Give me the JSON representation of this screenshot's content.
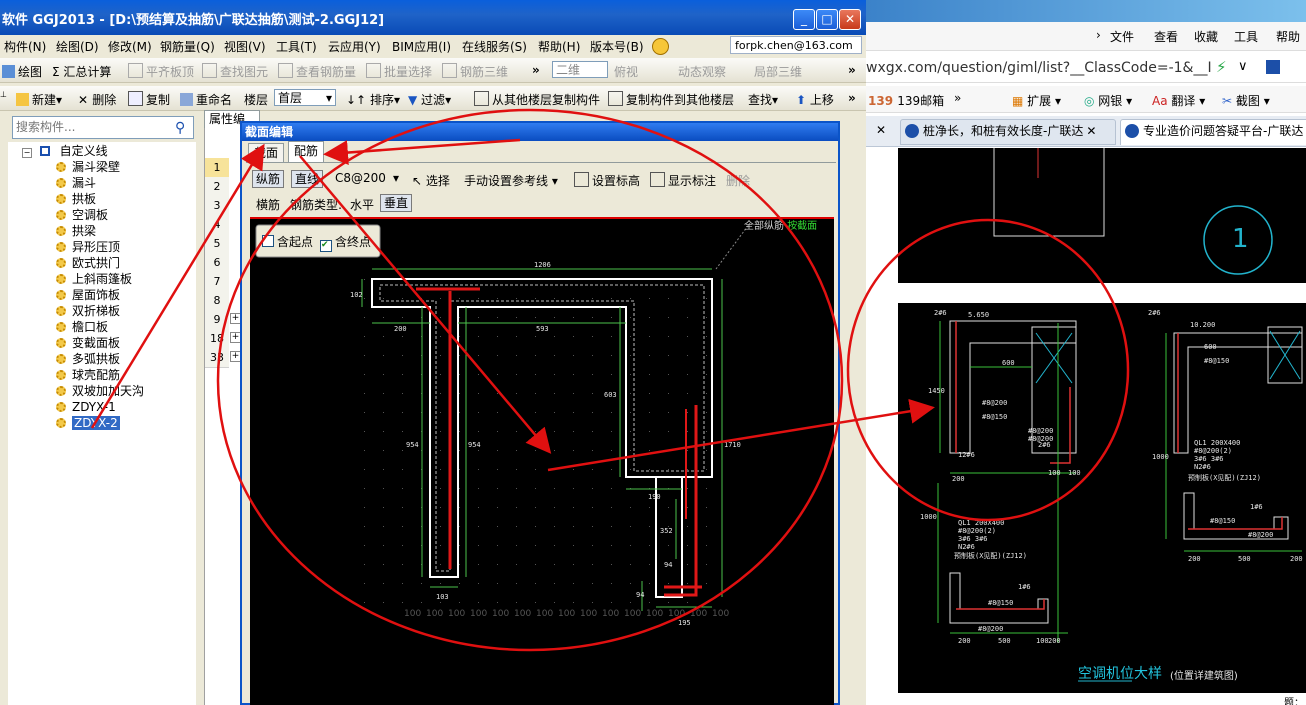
{
  "app": {
    "title": "软件 GGJ2013 - [D:\\预结算及抽筋\\广联达抽筋\\测试-2.GGJ12]",
    "menu": [
      "构件(N)",
      "绘图(D)",
      "修改(M)",
      "钢筋量(Q)",
      "视图(V)",
      "工具(T)",
      "云应用(Y)",
      "BIM应用(I)",
      "在线服务(S)",
      "帮助(H)",
      "版本号(B)"
    ],
    "account": "forpk.chen@163.com",
    "toolbar1": [
      "绘图",
      "Σ 汇总计算",
      "平齐板顶",
      "查找图元",
      "查看钢筋量",
      "批量选择",
      "钢筋三维",
      "二维",
      "俯视",
      "动态观察",
      "局部三维"
    ],
    "toolbar2": [
      "新建",
      "删除",
      "复制",
      "重命名",
      "楼层",
      "首层",
      "排序",
      "过滤",
      "从其他楼层复制构件",
      "复制构件到其他楼层",
      "查找",
      "上移"
    ],
    "search_placeholder": "搜索构件...",
    "tree": {
      "root": "自定义线",
      "items": [
        "漏斗梁壁",
        "漏斗",
        "拱板",
        "空调板",
        "拱梁",
        "异形压顶",
        "欧式拱门",
        "上斜雨篷板",
        "屋面饰板",
        "双折梯板",
        "檐口板",
        "变截面板",
        "多弧拱板",
        "球壳配筋",
        "双坡加加天沟",
        "ZDYX-1",
        "ZDYX-2"
      ],
      "selected": "ZDYX-2"
    },
    "prop_tab": "属性编辑",
    "row_numbers": [
      "1",
      "2",
      "3",
      "4",
      "5",
      "6",
      "7",
      "8",
      "9",
      "18",
      "33"
    ],
    "row_plus": [
      "+",
      "+",
      "+"
    ]
  },
  "dialog": {
    "title": "截面编辑",
    "tabs": [
      "截面",
      "配筋"
    ],
    "toolbar_a": {
      "zongjin": "纵筋",
      "zhixian": "直线",
      "spec": "C8@200",
      "select": "选择",
      "manual_ref": "手动设置参考线",
      "set_mark": "设置标高",
      "show_mark": "显示标注",
      "delete": "删除"
    },
    "toolbar_b": {
      "hengjin": "横筋",
      "rebar_type_label": "钢筋类型:",
      "horizontal": "水平",
      "vertical": "垂直"
    },
    "checkbox_start": "含起点",
    "checkbox_end": "含终点",
    "canvas_hint": "全部纵筋",
    "canvas_hint2": "按截面",
    "dims": {
      "d1206": "1206",
      "d102": "102",
      "d200": "200",
      "d593": "593",
      "d603": "603",
      "d954a": "954",
      "d954b": "954",
      "d190": "190",
      "d352": "352",
      "d94a": "94",
      "d94b": "94",
      "d103": "103",
      "d195": "195",
      "d1710": "1710"
    },
    "grid_labels": [
      "100",
      "100",
      "100",
      "100",
      "100",
      "100",
      "100",
      "100",
      "100",
      "100",
      "100",
      "100",
      "100",
      "100",
      "100"
    ]
  },
  "browser": {
    "menu": [
      "文件",
      "查看",
      "收藏",
      "工具",
      "帮助"
    ],
    "url": "wxgx.com/question/giml/list?__ClassCode=-1&__I",
    "bookmarks": [
      "139邮箱",
      "扩展",
      "网银",
      "翻译",
      "截图"
    ],
    "tabs": [
      "桩净长，和桩有效长度-广联达",
      "专业造价问题答疑平台-广联达"
    ],
    "drawing_title": "空调机位大样",
    "drawing_sub": "(位置详建筑图)",
    "circle_label": "1",
    "cad_labels": [
      "2#6",
      "5.650",
      "600",
      "1450",
      "#8@200",
      "#8@150",
      "12#6",
      "2#6",
      "#8@200",
      "#8@200",
      "100",
      "100",
      "200",
      "QL1 200X400",
      "#8@200(2)",
      "3#6 3#6",
      "N2#6",
      "预制板(X见配)(ZJ12)",
      "1#6",
      "#8@150",
      "#8@200",
      "200",
      "500",
      "100",
      "200",
      "2#6",
      "10.200",
      "600",
      "#8@150",
      "QL1 200X400",
      "#8@200(2)",
      "3#6 3#6",
      "N2#6",
      "预制板(X见配)(ZJ12)",
      "1#6",
      "#8@150",
      "#8@200",
      "200",
      "500",
      "200",
      "1000",
      "1000"
    ],
    "corner_text": "题："
  }
}
